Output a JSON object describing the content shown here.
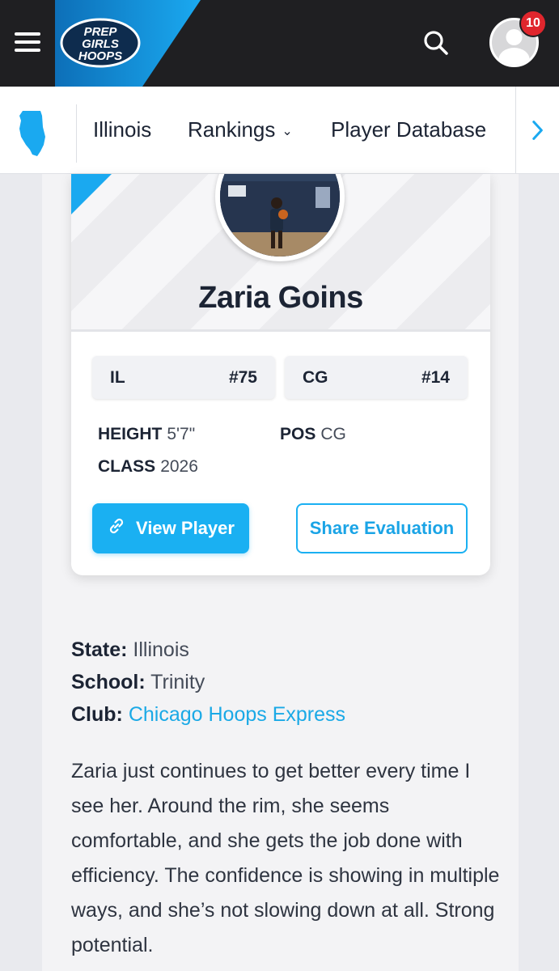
{
  "header": {
    "logo_text": [
      "PREP",
      "GIRLS",
      "HOOPS"
    ],
    "notification_count": "10",
    "icons": {
      "menu": "hamburger-icon",
      "search": "search-icon",
      "user": "user-avatar-icon"
    }
  },
  "subnav": {
    "state_icon": "illinois-state-icon",
    "items": [
      {
        "label": "Illinois"
      },
      {
        "label": "Rankings"
      },
      {
        "label": "Player Database"
      }
    ],
    "next_icon": "chevron-right-icon"
  },
  "player": {
    "name": "Zaria Goins",
    "rankings": [
      {
        "label": "IL",
        "rank": "#75"
      },
      {
        "label": "CG",
        "rank": "#14"
      }
    ],
    "height_label": "HEIGHT",
    "height": "5'7\"",
    "pos_label": "POS",
    "pos": "CG",
    "class_label": "CLASS",
    "class": "2026",
    "view_button": "View Player",
    "share_button": "Share Evaluation"
  },
  "details": {
    "state_label": "State:",
    "state": "Illinois",
    "school_label": "School:",
    "school": "Trinity",
    "club_label": "Club:",
    "club": "Chicago Hoops Express"
  },
  "evaluation": "Zaria just continues to get better every time I see her. Around the rim, she seems comfortable, and she gets the job done with efficiency. The confidence is showing in multiple ways, and she’s not slowing down at all. Strong potential.",
  "colors": {
    "accent": "#1ab0f2",
    "topbar": "#1f1f22",
    "badge": "#e0262d"
  }
}
